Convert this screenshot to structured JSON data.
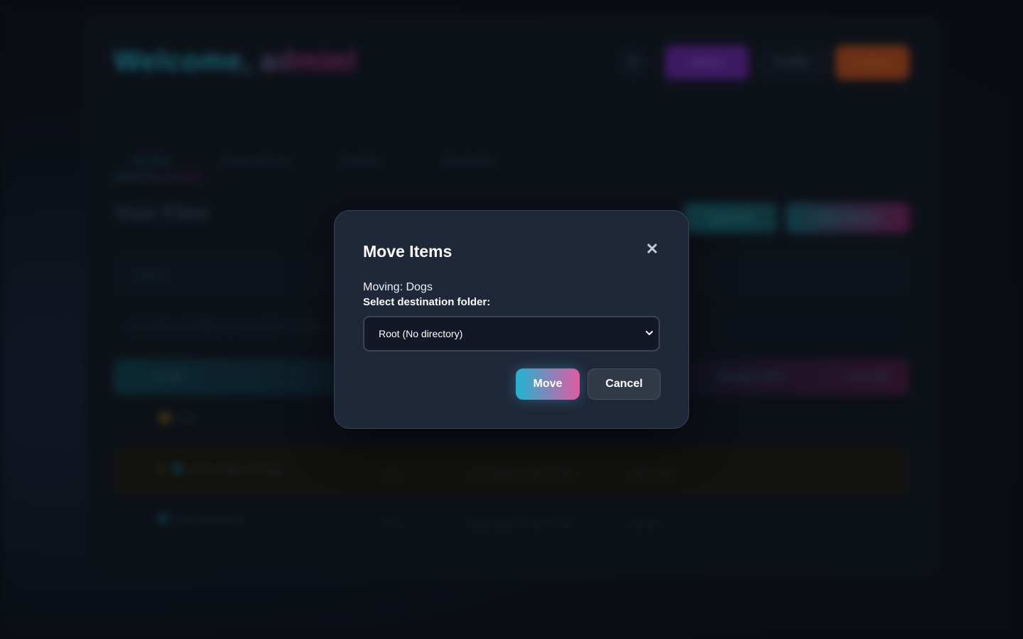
{
  "background": {
    "welcome_text": "Welcome, admin!",
    "header_icon": "gear-icon",
    "buttons": {
      "admin": "Admin",
      "profile": "Profile",
      "logout": "Logout"
    },
    "tabs": [
      "My Files",
      "Shared with me",
      "Favorites",
      "Recycle Bin"
    ],
    "section_title": "Your Files",
    "actions": {
      "upload": "Upload File",
      "create": "Create Directory"
    },
    "search_placeholder": "Search...",
    "notice": "Select files and folders to move, delete or share",
    "table_headers": [
      "NAME",
      "SHARED WITH",
      "ACTIONS"
    ],
    "rows": [
      {
        "name": "Dogs",
        "type": "folder",
        "size": "",
        "date": "",
        "shared": ""
      },
      {
        "name": "photo-holiday-2023.jpg",
        "type": "file",
        "size": "Yes",
        "date": "27.03.2025, 14:52:31 PM",
        "shared": "185.22 KB"
      },
      {
        "name": "Plug-Workshops",
        "type": "file",
        "size": "Yes",
        "date": "26.03.2025, 10:19:11 PM",
        "shared": "251 KB"
      }
    ]
  },
  "modal": {
    "title": "Move Items",
    "moving_text": "Moving: Dogs",
    "destination_label": "Select destination folder:",
    "select_value": "Root (No directory)",
    "move_label": "Move",
    "cancel_label": "Cancel",
    "close_glyph": "✕"
  }
}
